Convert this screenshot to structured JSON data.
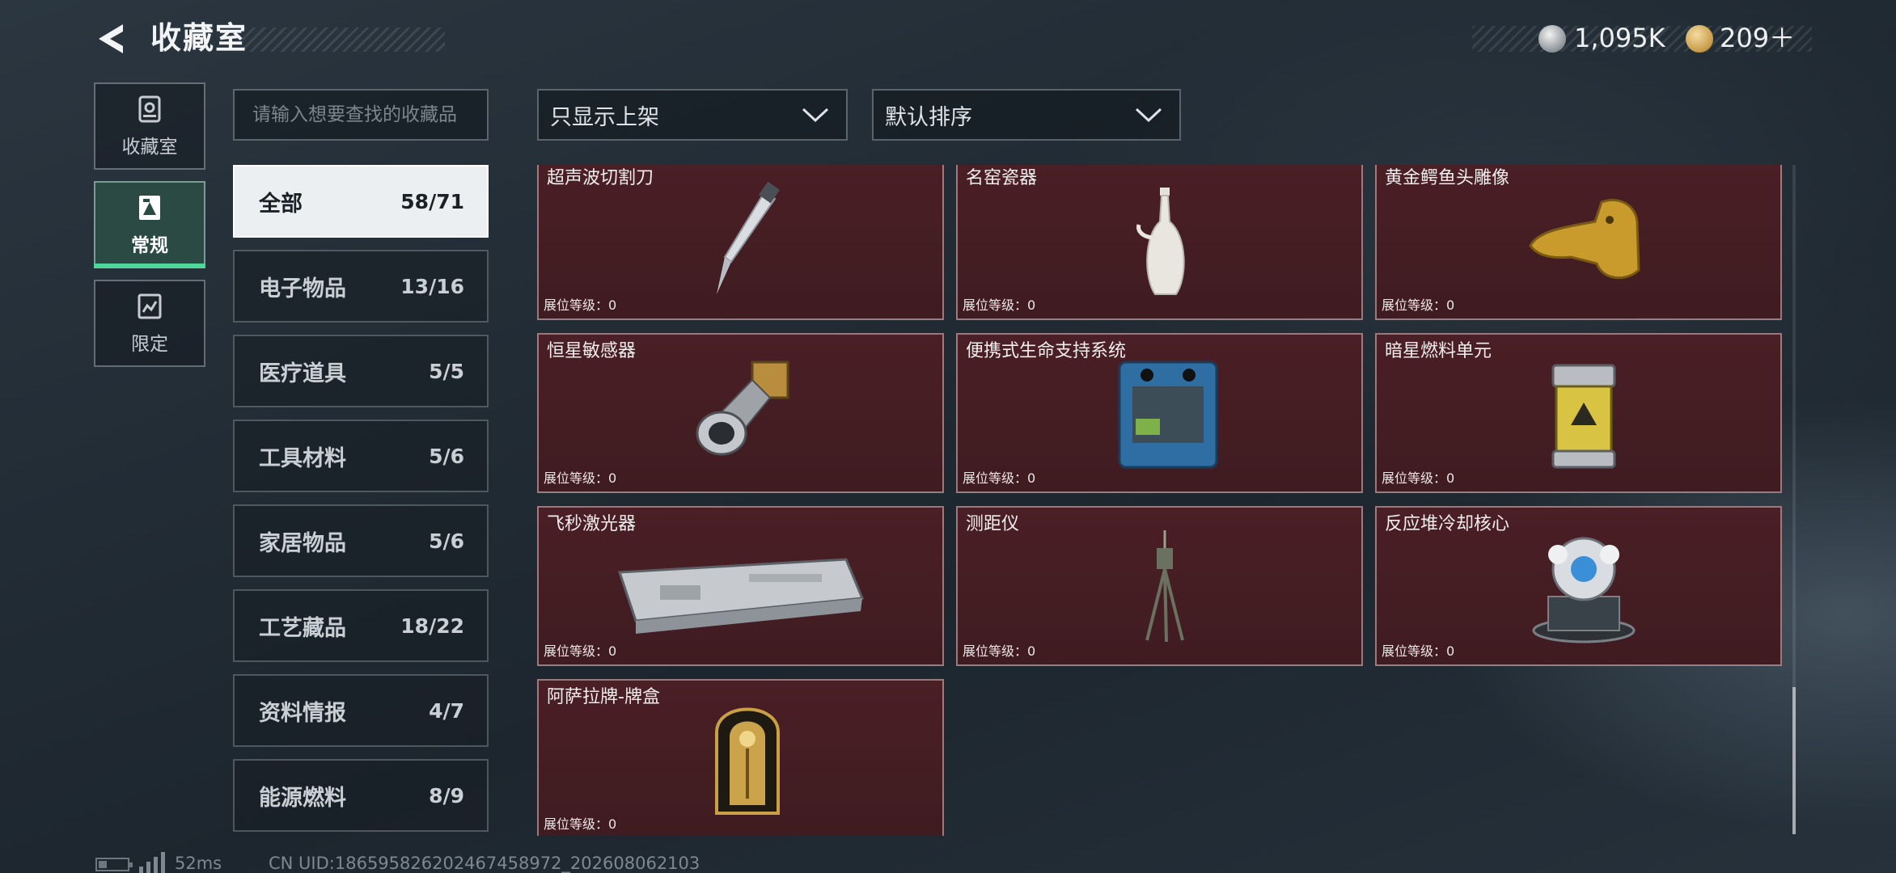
{
  "header": {
    "title": "收藏室",
    "currency": {
      "coin_value": "1,095K",
      "gem_value": "209＋"
    }
  },
  "nav": [
    {
      "label": "收藏室",
      "icon": "vault-icon",
      "active": false
    },
    {
      "label": "常规",
      "icon": "regular-collection-icon",
      "active": true
    },
    {
      "label": "限定",
      "icon": "limited-collection-icon",
      "active": false
    }
  ],
  "search": {
    "placeholder": "请输入想要查找的收藏品",
    "value": ""
  },
  "filters": {
    "shelf_filter": "只显示上架",
    "sort_order": "默认排序"
  },
  "categories": [
    {
      "name": "全部",
      "count": "58/71",
      "active": true
    },
    {
      "name": "电子物品",
      "count": "13/16"
    },
    {
      "name": "医疗道具",
      "count": "5/5"
    },
    {
      "name": "工具材料",
      "count": "5/6"
    },
    {
      "name": "家居物品",
      "count": "5/6"
    },
    {
      "name": "工艺藏品",
      "count": "18/22"
    },
    {
      "name": "资料情报",
      "count": "4/7"
    },
    {
      "name": "能源燃料",
      "count": "8/9"
    }
  ],
  "items": [
    {
      "name": "超声波切割刀",
      "level": "展位等级：0",
      "icon": "ultrasonic-cutter-icon"
    },
    {
      "name": "名窑瓷器",
      "level": "展位等级：0",
      "icon": "porcelain-vase-icon"
    },
    {
      "name": "黄金鳄鱼头雕像",
      "level": "展位等级：0",
      "icon": "golden-crocodile-head-icon"
    },
    {
      "name": "恒星敏感器",
      "level": "展位等级：0",
      "icon": "star-sensor-icon"
    },
    {
      "name": "便携式生命支持系统",
      "level": "展位等级：0",
      "icon": "life-support-system-icon"
    },
    {
      "name": "暗星燃料单元",
      "level": "展位等级：0",
      "icon": "fuel-cell-icon"
    },
    {
      "name": "飞秒激光器",
      "level": "展位等级：0",
      "icon": "femtosecond-laser-icon"
    },
    {
      "name": "测距仪",
      "level": "展位等级：0",
      "icon": "rangefinder-tripod-icon"
    },
    {
      "name": "反应堆冷却核心",
      "level": "展位等级：0",
      "icon": "reactor-cooling-core-icon"
    },
    {
      "name": "阿萨拉牌-牌盒",
      "level": "展位等级：0",
      "icon": "card-box-icon"
    }
  ],
  "footer": {
    "ping": "52ms",
    "uid": "CN UID:1865958262024674589​72_202608062103"
  }
}
